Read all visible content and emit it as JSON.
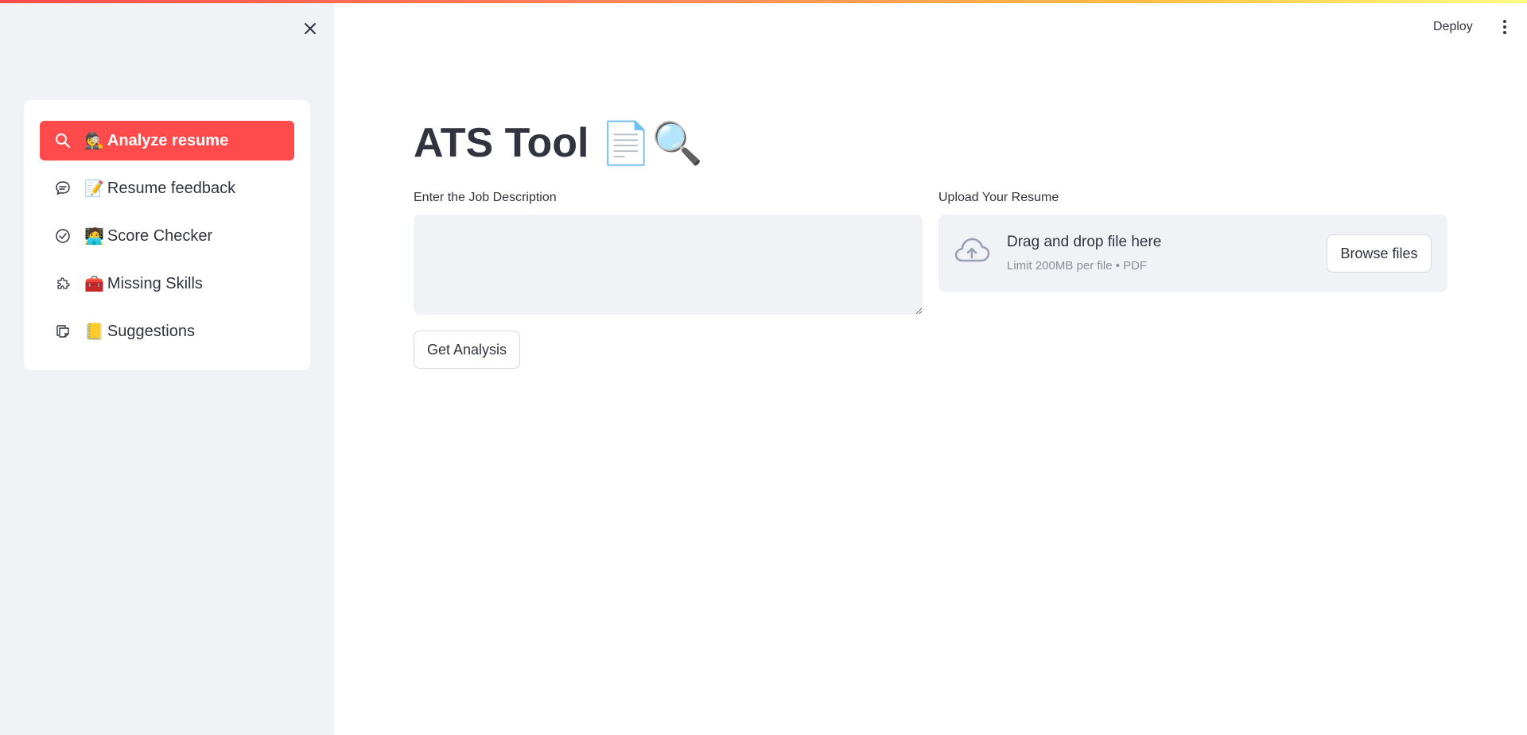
{
  "header": {
    "deploy_label": "Deploy",
    "menu_icon": "vertical-dots-icon"
  },
  "sidebar": {
    "close_icon": "close-icon",
    "items": [
      {
        "icon": "search-icon",
        "emoji": "🕵️",
        "label": "Analyze resume",
        "active": true
      },
      {
        "icon": "chat-bubble-icon",
        "emoji": "📝",
        "label": " Resume feedback",
        "active": false
      },
      {
        "icon": "check-circle-icon",
        "emoji": "🧑‍💻",
        "label": "Score Checker",
        "active": false
      },
      {
        "icon": "puzzle-icon",
        "emoji": "🧰",
        "label": " Missing Skills",
        "active": false
      },
      {
        "icon": "sticky-note-icon",
        "emoji": "📒",
        "label": "Suggestions",
        "active": false
      }
    ]
  },
  "main": {
    "title": "ATS Tool",
    "title_emoji": "📄🔍",
    "job_description_label": "Enter the Job Description",
    "job_description_value": "",
    "upload_label": "Upload Your Resume",
    "dropzone_title": "Drag and drop file here",
    "dropzone_subtitle": "Limit 200MB per file • PDF",
    "browse_label": "Browse files",
    "analysis_button_label": "Get Analysis"
  },
  "colors": {
    "accent": "#ff4b4b",
    "sidebar_bg": "#f0f2f6",
    "text": "#31333f",
    "muted": "#8b8e98"
  }
}
